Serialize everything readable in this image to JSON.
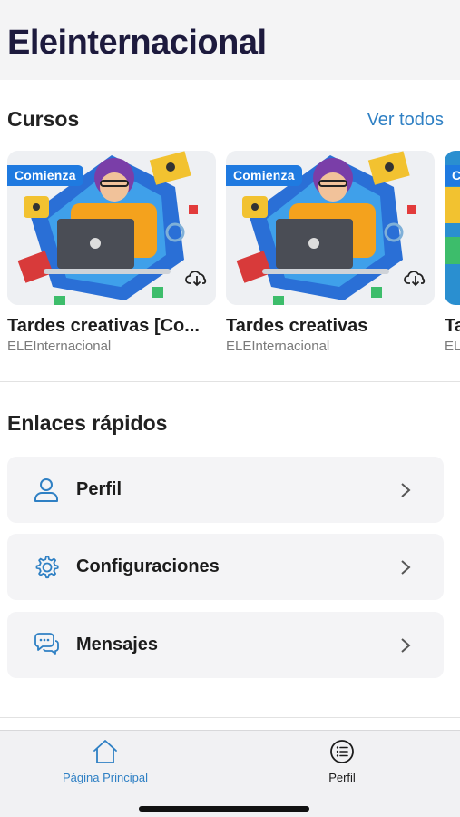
{
  "header": {
    "title": "Eleinternacional"
  },
  "courses": {
    "title": "Cursos",
    "see_all": "Ver todos",
    "items": [
      {
        "name": "Tardes creativas [Co...",
        "author": "ELEInternacional",
        "badge": "Comienza"
      },
      {
        "name": "Tardes creativas",
        "author": "ELEInternacional",
        "badge": "Comienza"
      },
      {
        "name": "Ta",
        "author": "EL",
        "badge": "C"
      }
    ]
  },
  "quick_links": {
    "title": "Enlaces rápidos",
    "items": [
      {
        "label": "Perfil",
        "icon": "user-icon"
      },
      {
        "label": "Configuraciones",
        "icon": "gear-icon"
      },
      {
        "label": "Mensajes",
        "icon": "chat-bubbles-icon"
      }
    ]
  },
  "bottom_nav": {
    "items": [
      {
        "label": "Página Principal",
        "icon": "home-icon",
        "active": true
      },
      {
        "label": "Perfil",
        "icon": "list-circle-icon",
        "active": false
      }
    ]
  },
  "colors": {
    "accent": "#2f80c4",
    "badge": "#1f7ae0",
    "title": "#1d1a3d"
  }
}
